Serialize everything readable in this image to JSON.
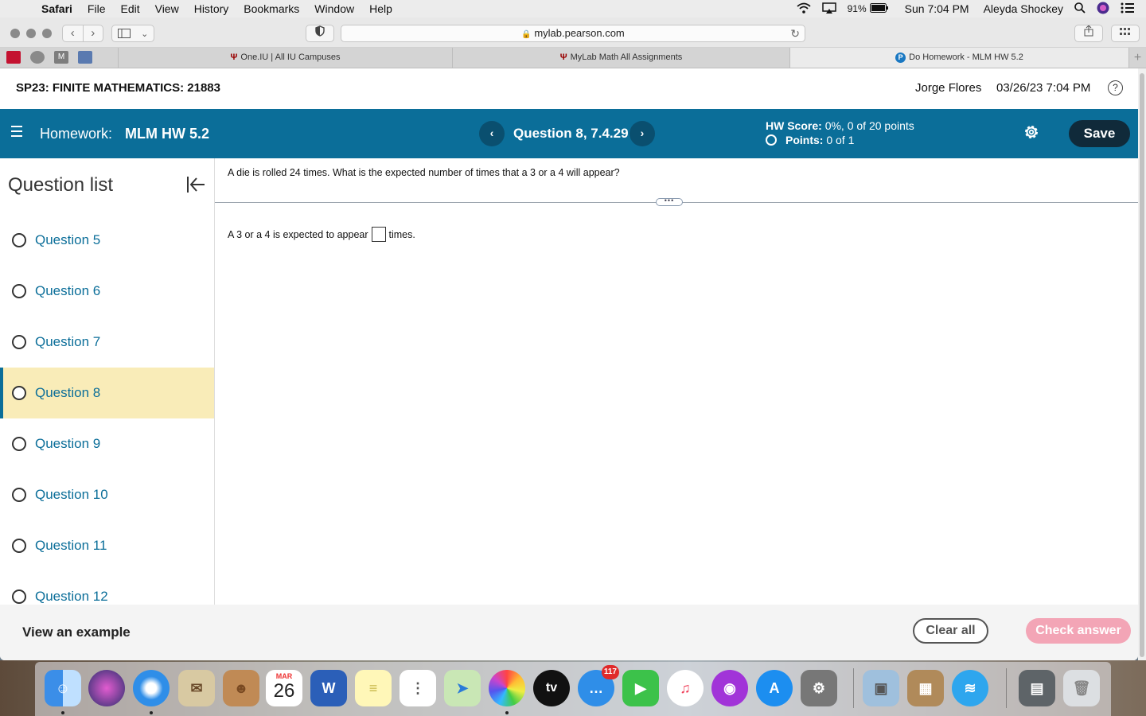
{
  "menubar": {
    "app": "Safari",
    "items": [
      "File",
      "Edit",
      "View",
      "History",
      "Bookmarks",
      "Window",
      "Help"
    ],
    "battery": "91%",
    "clock": "Sun 7:04 PM",
    "user": "Aleyda Shockey"
  },
  "browser": {
    "url": "mylab.pearson.com",
    "tabs": [
      {
        "title": "One.IU | All IU Campuses"
      },
      {
        "title": "MyLab Math All Assignments"
      },
      {
        "title": "Do Homework - MLM HW 5.2"
      }
    ],
    "favorites": [
      "M"
    ]
  },
  "course": {
    "name": "SP23: FINITE MATHEMATICS: 21883",
    "user": "Jorge Flores",
    "datetime": "03/26/23 7:04 PM",
    "help_glyph": "?"
  },
  "hwbar": {
    "label": "Homework:",
    "name": "MLM HW 5.2",
    "question_title": "Question 8, 7.4.29",
    "prev_glyph": "‹",
    "next_glyph": "›",
    "score_label": "HW Score:",
    "score_value": "0%, 0 of 20 points",
    "points_label": "Points:",
    "points_value": "0 of 1",
    "save_label": "Save"
  },
  "question_list": {
    "heading": "Question list",
    "items": [
      {
        "label": "Question 5"
      },
      {
        "label": "Question 6"
      },
      {
        "label": "Question 7"
      },
      {
        "label": "Question 8"
      },
      {
        "label": "Question 9"
      },
      {
        "label": "Question 10"
      },
      {
        "label": "Question 11"
      },
      {
        "label": "Question 12"
      }
    ],
    "current": "Question 8"
  },
  "question": {
    "prompt": "A die is rolled 24 times. What is the expected number of times that a 3 or a 4 will appear?",
    "divider_glyph": "•••",
    "answer_before": "A 3 or a 4 is expected to appear",
    "answer_after": "times."
  },
  "footer": {
    "example_label": "View an example",
    "clear_label": "Clear all",
    "check_label": "Check answer"
  },
  "dock": {
    "calendar_month": "MAR",
    "calendar_day": "26",
    "word_letter": "W",
    "tv_label": "tv",
    "messages_badge": "117"
  },
  "colors": {
    "brand": "#0b6e99",
    "current_question_bg": "#f9ecb8",
    "check_answer_bg": "#f3a5b6",
    "save_bg": "#102a3a"
  }
}
